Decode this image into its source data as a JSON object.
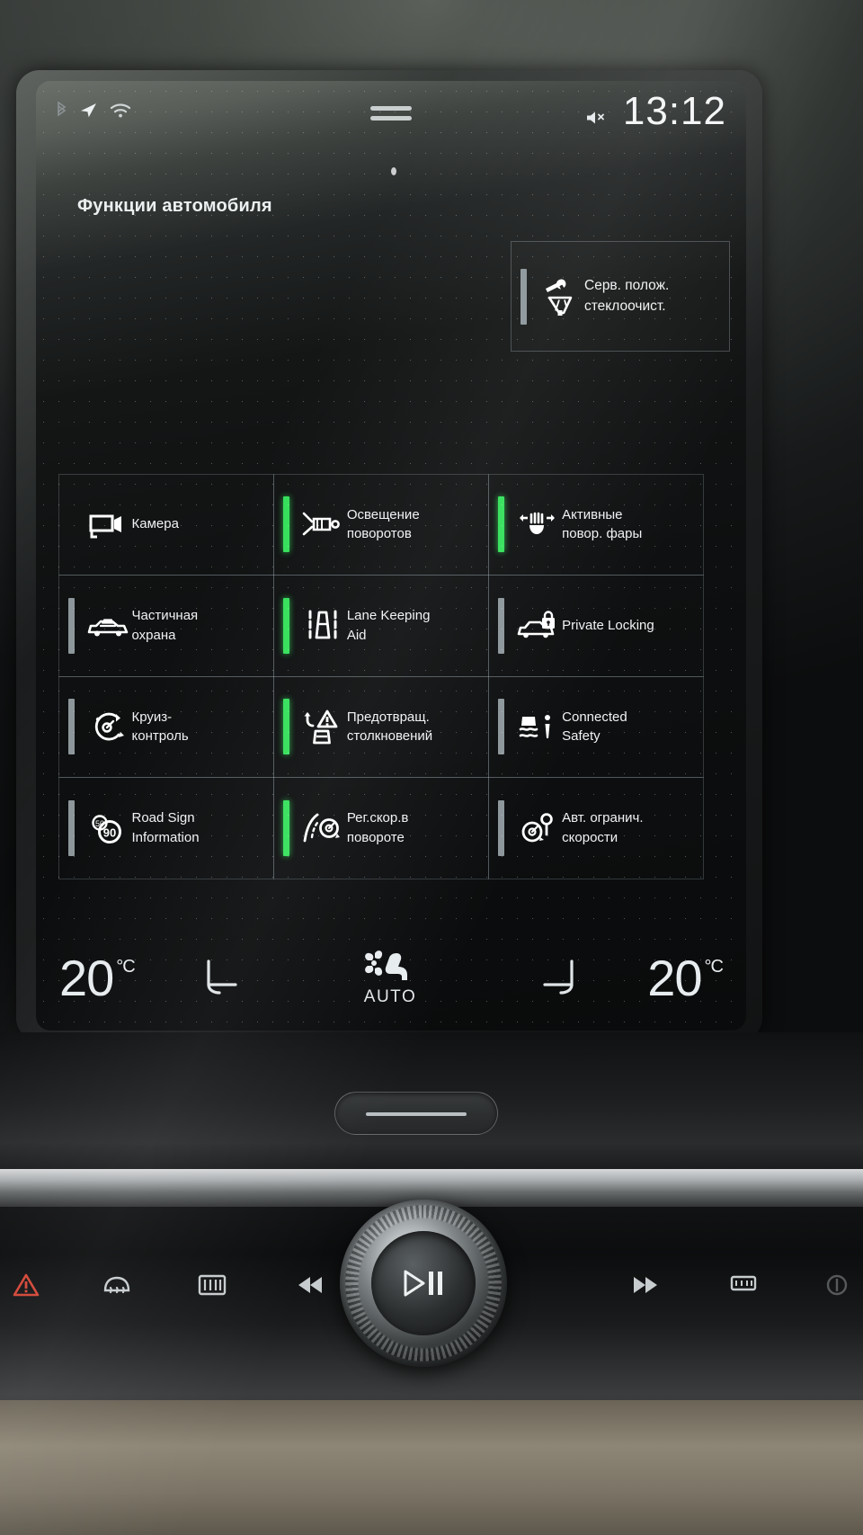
{
  "statusbar": {
    "bluetooth_icon": "bluetooth-icon",
    "navigation_icon": "navigation-arrow-icon",
    "wifi_icon": "wifi-icon",
    "drag_handle_icon": "drag-handle-icon",
    "mute_icon": "volume-mute-icon",
    "clock": "13:12"
  },
  "page": {
    "title": "Функции автомобиля"
  },
  "top_tile": {
    "label_line1": "Серв. полож.",
    "label_line2": "стеклоочист.",
    "icon": "wiper-service-position-icon",
    "indicator": "none"
  },
  "grid": {
    "tiles": [
      {
        "label_line1": "Камера",
        "label_line2": "",
        "icon": "camera-icon",
        "indicator": "none"
      },
      {
        "label_line1": "Освещение",
        "label_line2": "поворотов",
        "icon": "cornering-light-icon",
        "indicator": "on"
      },
      {
        "label_line1": "Активные",
        "label_line2": "повор. фары",
        "icon": "active-bending-lights-icon",
        "indicator": "on"
      },
      {
        "label_line1": "Частичная",
        "label_line2": "охрана",
        "icon": "reduced-guard-icon",
        "indicator": "off"
      },
      {
        "label_line1": "Lane Keeping",
        "label_line2": "Aid",
        "icon": "lane-keeping-aid-icon",
        "indicator": "on"
      },
      {
        "label_line1": "Private Locking",
        "label_line2": "",
        "icon": "private-locking-icon",
        "indicator": "off"
      },
      {
        "label_line1": "Круиз-",
        "label_line2": "контроль",
        "icon": "cruise-control-icon",
        "indicator": "off"
      },
      {
        "label_line1": "Предотвращ.",
        "label_line2": "столкновений",
        "icon": "collision-avoidance-icon",
        "indicator": "on"
      },
      {
        "label_line1": "Connected",
        "label_line2": "Safety",
        "icon": "connected-safety-icon",
        "indicator": "off"
      },
      {
        "label_line1": "Road Sign",
        "label_line2": "Information",
        "icon": "road-sign-information-icon",
        "indicator": "off"
      },
      {
        "label_line1": "Рег.скор.в",
        "label_line2": "повороте",
        "icon": "curve-speed-adaptation-icon",
        "indicator": "on"
      },
      {
        "label_line1": "Авт. огранич.",
        "label_line2": "скорости",
        "icon": "auto-speed-limiter-icon",
        "indicator": "off"
      }
    ]
  },
  "climate": {
    "left_temp": "20",
    "left_unit": "°C",
    "right_temp": "20",
    "right_unit": "°C",
    "left_seat_icon": "seat-heating-left-icon",
    "right_seat_icon": "seat-heating-right-icon",
    "fan_icon": "fan-icon",
    "airflow_icon": "airflow-seat-icon",
    "auto_label": "AUTO"
  },
  "console": {
    "hazard_icon": "hazard-warning-icon",
    "rear_defrost_icon": "rear-window-defrost-icon",
    "front_defrost_icon": "front-windscreen-defrost-icon",
    "prev_track_icon": "previous-track-icon",
    "next_track_icon": "next-track-icon",
    "seat_heat_icon": "seat-heat-icon",
    "play_pause_icon": "play-pause-icon",
    "volume_knob": "volume-knob"
  },
  "colors": {
    "indicator_on": "#34e05a",
    "indicator_off": "#8d979b",
    "text": "#f0f3f4",
    "screen_bg": "#0a0b0c"
  }
}
